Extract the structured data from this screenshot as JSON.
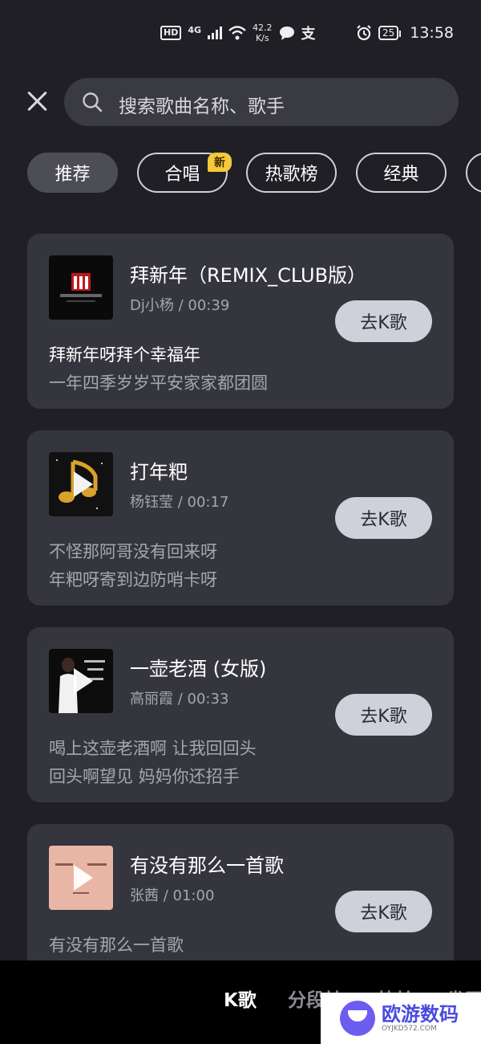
{
  "status_bar": {
    "hd": "HD",
    "network": "4G",
    "speed_value": "42.2",
    "speed_unit": "K/s",
    "battery": "25",
    "time": "13:58",
    "icons": [
      "signal-icon",
      "wifi-icon",
      "chat-icon",
      "alipay-icon",
      "alarm-icon",
      "battery-icon"
    ]
  },
  "search": {
    "placeholder": "搜索歌曲名称、歌手"
  },
  "tabs": [
    {
      "label": "推荐",
      "active": true
    },
    {
      "label": "合唱",
      "badge": "新"
    },
    {
      "label": "热歌榜"
    },
    {
      "label": "经典"
    }
  ],
  "songs": [
    {
      "title": "拜新年（REMIX_CLUB版）",
      "artist": "Dj小杨",
      "duration": "00:39",
      "button": "去K歌",
      "lyrics": [
        "拜新年呀拜个幸福年",
        "一年四季岁岁平安家家都团圆"
      ]
    },
    {
      "title": "打年粑",
      "artist": "杨钰莹",
      "duration": "00:17",
      "button": "去K歌",
      "lyrics": [
        "不怪那阿哥没有回来呀",
        "年粑呀寄到边防哨卡呀"
      ]
    },
    {
      "title": "一壶老酒 (女版)",
      "artist": "高丽霞",
      "duration": "00:33",
      "button": "去K歌",
      "lyrics": [
        "喝上这壶老酒啊 让我回回头",
        "回头啊望见 妈妈你还招手"
      ]
    },
    {
      "title": "有没有那么一首歌",
      "artist": "张茜",
      "duration": "01:00",
      "button": "去K歌",
      "lyrics": [
        "有没有那么一首歌",
        ""
      ]
    }
  ],
  "bottom_nav": [
    {
      "label": "K歌",
      "active": true
    },
    {
      "label": "分段拍"
    },
    {
      "label": "快拍"
    },
    {
      "label": "发图"
    }
  ],
  "watermark": {
    "title": "欧游数码",
    "sub": "OYJKD572.COM"
  },
  "colors": {
    "background": "#1f1f25",
    "card": "#35353d",
    "button": "#d0d0da",
    "badge": "#f4c93a"
  }
}
